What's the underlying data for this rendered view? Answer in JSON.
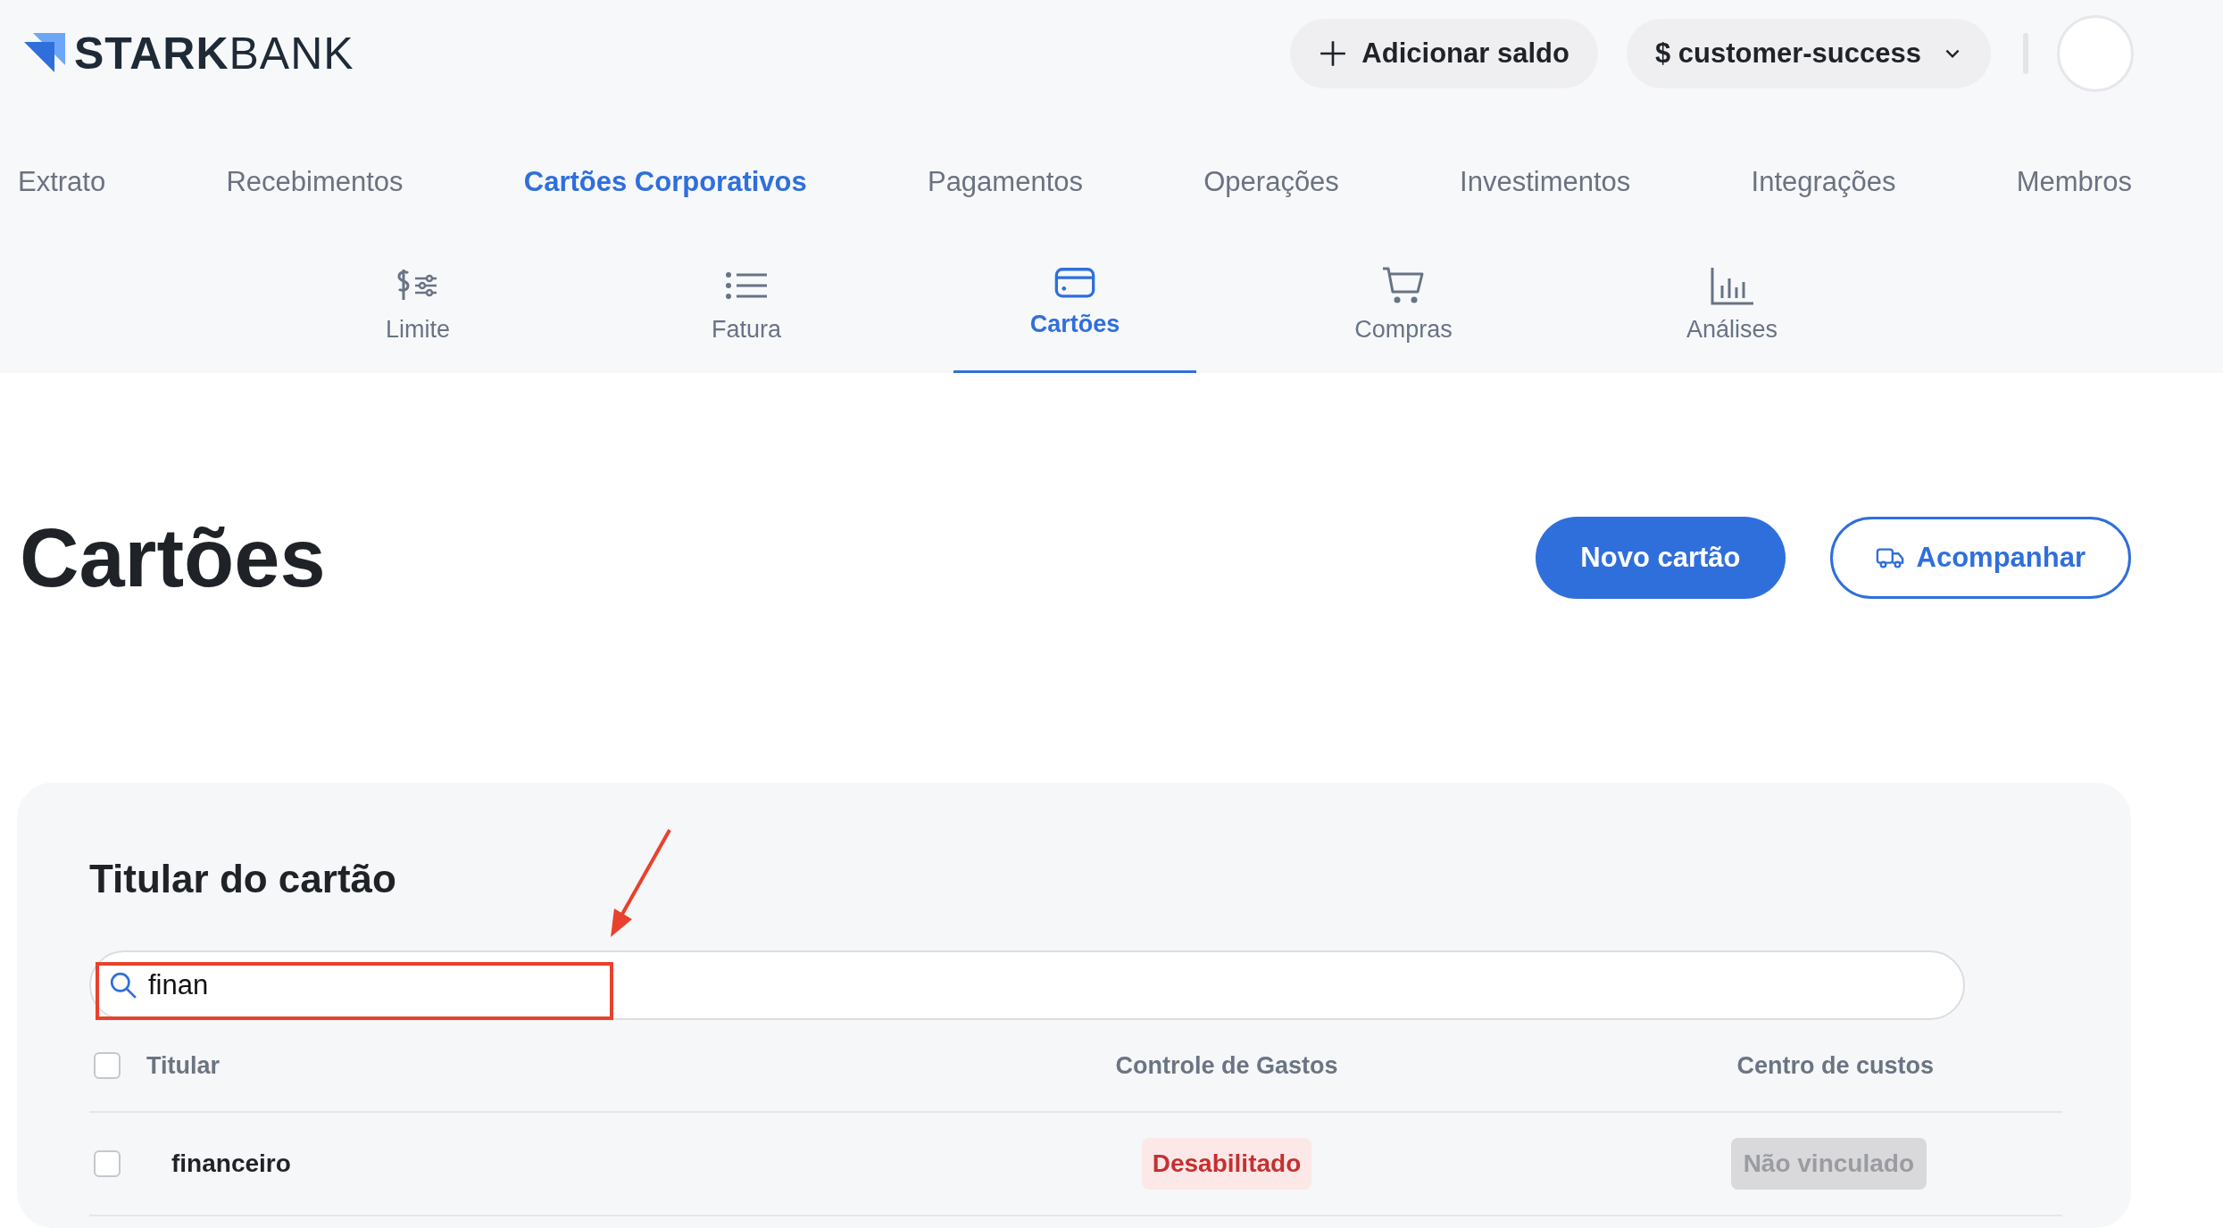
{
  "brand": {
    "strong": "STARK",
    "light": "BANK"
  },
  "header_actions": {
    "add_balance": "Adicionar saldo",
    "workspace": "$ customer-success"
  },
  "main_nav": [
    {
      "label": "Extrato",
      "selected": false
    },
    {
      "label": "Recebimentos",
      "selected": false
    },
    {
      "label": "Cartões Corporativos",
      "selected": true
    },
    {
      "label": "Pagamentos",
      "selected": false
    },
    {
      "label": "Operações",
      "selected": false
    },
    {
      "label": "Investimentos",
      "selected": false
    },
    {
      "label": "Integrações",
      "selected": false
    },
    {
      "label": "Membros",
      "selected": false
    }
  ],
  "sub_nav": [
    {
      "label": "Limite",
      "selected": false
    },
    {
      "label": "Fatura",
      "selected": false
    },
    {
      "label": "Cartões",
      "selected": true
    },
    {
      "label": "Compras",
      "selected": false
    },
    {
      "label": "Análises",
      "selected": false
    }
  ],
  "page_title": "Cartões",
  "buttons": {
    "primary": "Novo cartão",
    "secondary": "Acompanhar"
  },
  "filter": {
    "title": "Titular do cartão",
    "search_value": "finan"
  },
  "table": {
    "select_all_checked": false,
    "columns": [
      "Titular",
      "Controle de Gastos",
      "Centro de custos"
    ],
    "rows": [
      {
        "checked": false,
        "holder": "financeiro",
        "spending_control": {
          "text": "Desabilitado",
          "kind": "danger"
        },
        "cost_center": {
          "text": "Não vinculado",
          "kind": "muted"
        }
      }
    ]
  }
}
